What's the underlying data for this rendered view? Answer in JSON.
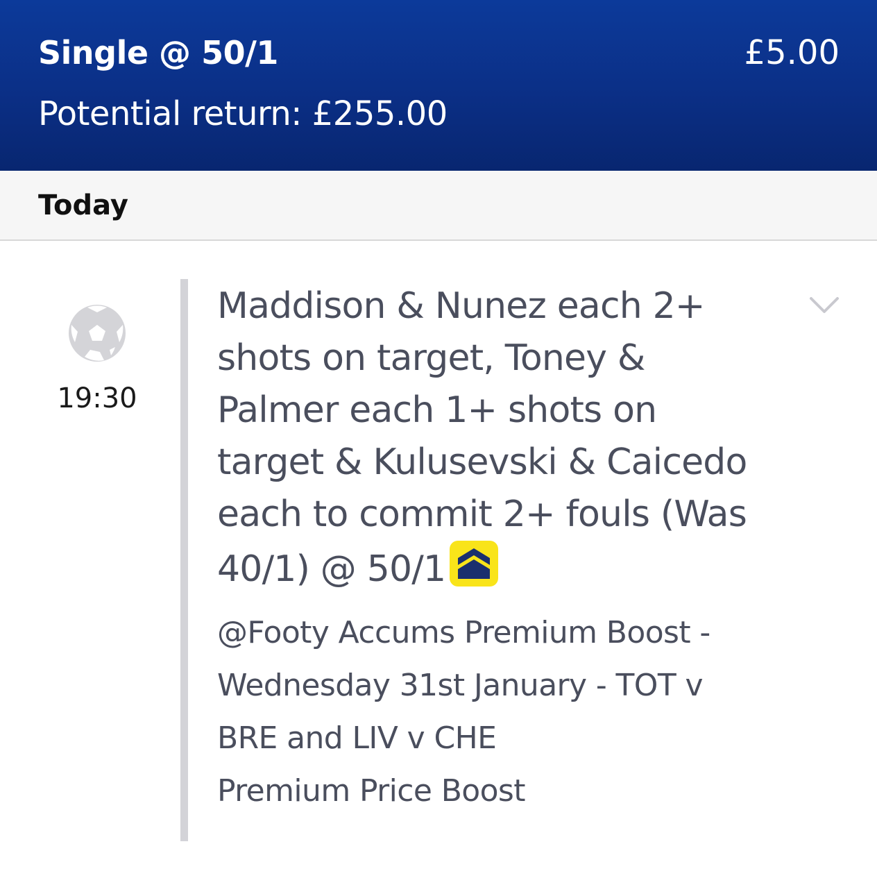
{
  "header": {
    "bet_type": "Single @ 50/1",
    "stake": "£5.00",
    "potential_return": "Potential return: £255.00"
  },
  "day_section": {
    "label": "Today"
  },
  "event": {
    "sport_icon": "football-icon",
    "time": "19:30",
    "selection_lines": [
      "Maddison & Nunez each 2+",
      "shots on target, Toney &",
      "Palmer each 1+ shots on",
      "target & Kulusevski & Caicedo",
      "each to commit 2+ fouls (Was",
      "40/1) @ 50/1"
    ],
    "boost_icon": "price-boost-icon",
    "expand_icon": "chevron-down-icon",
    "market_lines": [
      "@Footy Accums Premium Boost -",
      "Wednesday 31st January - TOT v",
      "BRE and LIV v CHE",
      "Premium Price Boost"
    ]
  },
  "colors": {
    "header_bg": "#0b2f86",
    "day_bar_bg": "#f6f6f6",
    "text_primary": "#4a4e5d",
    "boost_badge": "#f9e41a",
    "boost_arrow": "#1b2f6e",
    "divider": "#d3d3d8"
  }
}
